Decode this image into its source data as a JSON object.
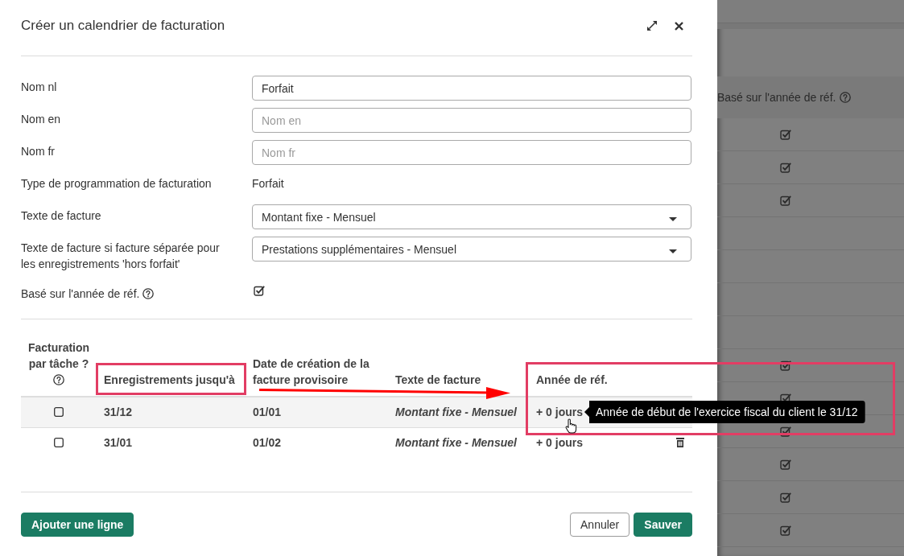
{
  "dialog": {
    "title": "Créer un calendrier de facturation",
    "form": [
      {
        "kind": "input",
        "label": "Nom nl",
        "help": false,
        "value": "Forfait"
      },
      {
        "kind": "input",
        "label": "Nom en",
        "help": false,
        "placeholder": "Nom en"
      },
      {
        "kind": "input",
        "label": "Nom fr",
        "help": false,
        "placeholder": "Nom fr"
      },
      {
        "kind": "text",
        "label": "Type de programmation de facturation",
        "help": false,
        "value": "Forfait"
      },
      {
        "kind": "select",
        "label": "Texte de facture",
        "help": false,
        "value": "Montant fixe - Mensuel"
      },
      {
        "kind": "select",
        "label": "Texte de facture si facture séparée pour les enregistrements 'hors forfait'",
        "help": false,
        "value": "Prestations supplémentaires - Mensuel"
      },
      {
        "kind": "checkbox",
        "label": "Basé sur l'année de réf.",
        "help": true,
        "checked": true
      }
    ],
    "table": {
      "columns": [
        {
          "label": "Facturation par tâche ?",
          "help": true
        },
        {
          "label": "Enregistrements jusqu'à",
          "help": false
        },
        {
          "label": "Date de création de la facture provisoire",
          "help": false
        },
        {
          "label": "Texte de facture",
          "help": false
        },
        {
          "label": "Année de réf.",
          "help": false
        }
      ],
      "rows": [
        {
          "hovered": true,
          "per_task": false,
          "until": "31/12",
          "invoice_date": "01/01",
          "invoice_text": "Montant fixe - Mensuel",
          "reference_year": "+ 0 jours",
          "tooltip": "Année de début de l'exercice fiscal du client le 31/12",
          "deletable": false
        },
        {
          "hovered": false,
          "per_task": false,
          "until": "31/01",
          "invoice_date": "01/02",
          "invoice_text": "Montant fixe - Mensuel",
          "reference_year": "+ 0 jours",
          "deletable": true
        }
      ]
    },
    "footer": {
      "left_buttons": [
        {
          "label": "Ajouter une ligne",
          "kind": "primary"
        }
      ],
      "right_buttons": [
        {
          "label": "Annuler",
          "kind": "secondary"
        },
        {
          "label": "Sauver",
          "kind": "primary"
        }
      ]
    }
  },
  "background_page": {
    "column_header": "Basé sur l'année de réf.",
    "column_help": true,
    "rows": [
      {
        "checked": true
      },
      {
        "checked": true
      },
      {
        "checked": true
      },
      {
        "checked": false
      },
      {
        "checked": false
      },
      {
        "checked": false
      },
      {
        "checked": false
      },
      {
        "checked": true
      },
      {
        "checked": true
      },
      {
        "checked": true
      },
      {
        "checked": true
      },
      {
        "checked": true
      },
      {
        "checked": true
      }
    ]
  }
}
